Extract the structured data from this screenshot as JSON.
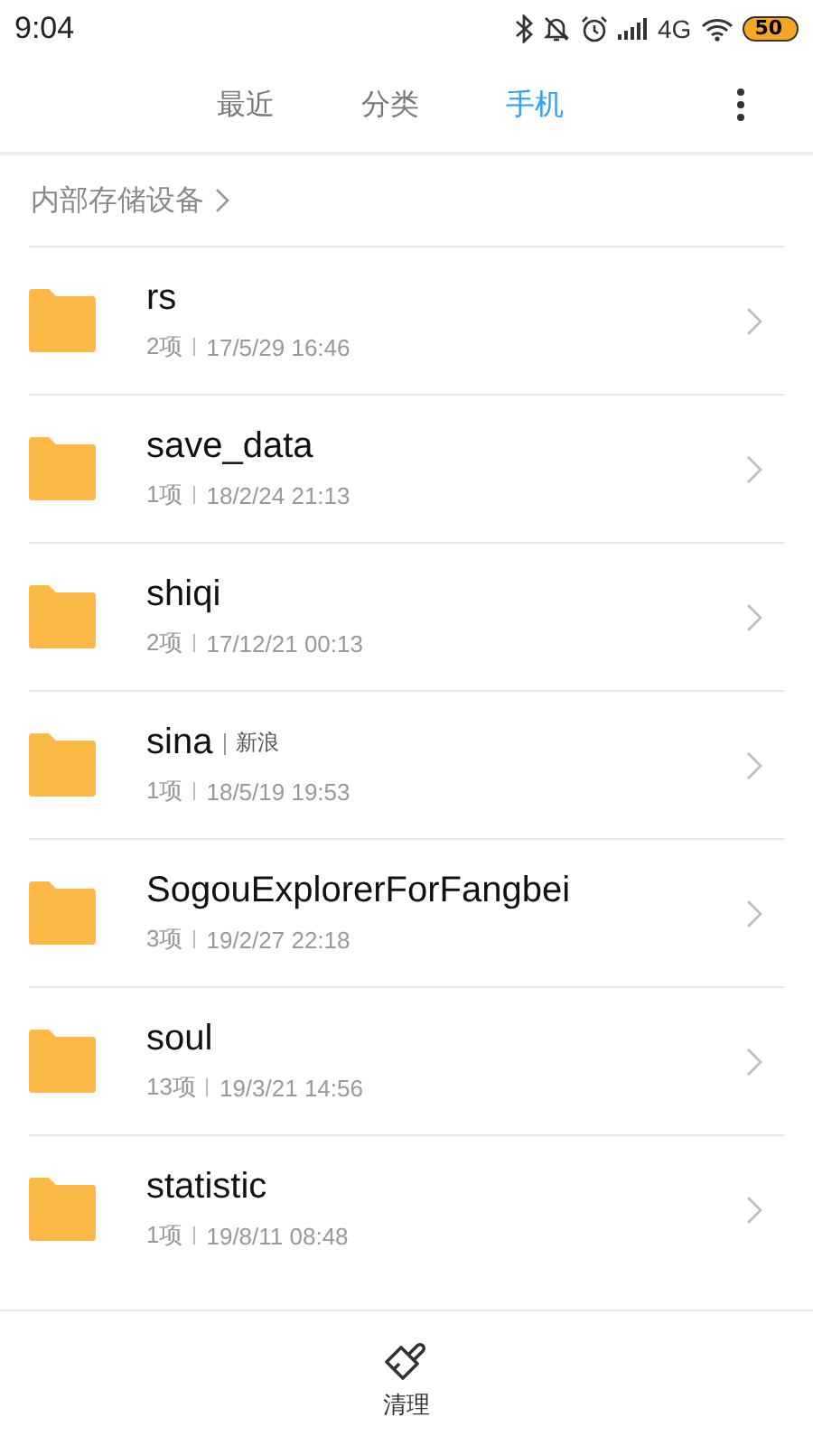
{
  "status_bar": {
    "time": "9:04",
    "network": "4G",
    "battery": "50"
  },
  "tabs": [
    {
      "label": "最近",
      "selected": false
    },
    {
      "label": "分类",
      "selected": false
    },
    {
      "label": "手机",
      "selected": true
    }
  ],
  "breadcrumb": "内部存储设备",
  "folders": [
    {
      "name": "rs",
      "count": "2项",
      "date": "17/5/29 16:46"
    },
    {
      "name": "save_data",
      "count": "1项",
      "date": "18/2/24 21:13"
    },
    {
      "name": "shiqi",
      "count": "2项",
      "date": "17/12/21 00:13"
    },
    {
      "name": "sina",
      "tag": "新浪",
      "count": "1项",
      "date": "18/5/19 19:53"
    },
    {
      "name": "SogouExplorerForFangbei",
      "count": "3项",
      "date": "19/2/27 22:18"
    },
    {
      "name": "soul",
      "count": "13项",
      "date": "19/3/21 14:56"
    },
    {
      "name": "statistic",
      "count": "1项",
      "date": "19/8/11 08:48"
    }
  ],
  "bottom_bar": {
    "label": "清理"
  }
}
